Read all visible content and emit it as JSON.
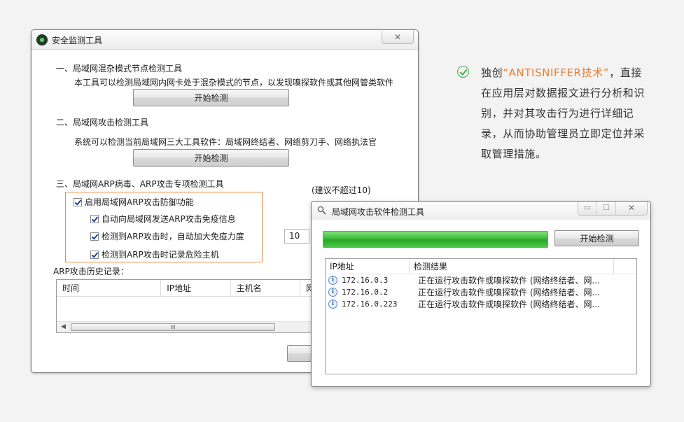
{
  "main_window": {
    "title": "安全监测工具",
    "close_glyph": "✕",
    "section1": {
      "title": "一、局域网混杂模式节点检测工具",
      "desc": "本工具可以检测局域网内网卡处于混杂模式的节点，以发现嗅探软件或其他网管类软件",
      "button": "开始检测"
    },
    "section2": {
      "title": "二、局域网攻击检测工具",
      "desc": "系统可以检测当前局域网三大工具软件：局域网终结者、网络剪刀手、网络执法官",
      "button": "开始检测"
    },
    "section3": {
      "title": "三、局域网ARP病毒、ARP攻击专项检测工具",
      "hint": "(建议不超过10)",
      "enable_label": "启用局域网ARP攻击防御功能",
      "opt1_label": "自动向局域网发送ARP攻击免疫信息",
      "opt2_label": "检测到ARP攻击时，自动加大免疫力度",
      "opt3_label": "检测到ARP攻击时记录危险主机",
      "immunity_value": "10",
      "checked": [
        true,
        true,
        true,
        true
      ]
    },
    "history": {
      "label": "ARP攻击历史记录：",
      "columns": [
        "时间",
        "IP地址",
        "主机名",
        "网"
      ],
      "scroll_grip": "III"
    }
  },
  "detect_window": {
    "title": "局域网攻击软件检测工具",
    "min_glyph": "▭",
    "max_glyph": "☐",
    "close_glyph": "✕",
    "progress": 1.0,
    "button": "开始检测",
    "columns": [
      "IP地址",
      "检测结果"
    ],
    "rows": [
      {
        "ip": "172.16.0.3",
        "result": "正在运行攻击软件或嗅探软件 (网络终结者、网..."
      },
      {
        "ip": "172.16.0.2",
        "result": "正在运行攻击软件或嗅探软件 (网络终结者、网..."
      },
      {
        "ip": "172.16.0.223",
        "result": "正在运行攻击软件或嗅探软件 (网络终结者、网..."
      }
    ]
  },
  "feature": {
    "prefix": "独创",
    "highlight": "“ANTISNIFFER技术”",
    "body": "，直接在应用层对数据报文进行分析和识别，并对其攻击行为进行详细记录，从而协助管理员立即定位并采取管理措施。"
  },
  "colors": {
    "accent_orange": "#f07c2d",
    "check_green": "#3fae49",
    "progress_green": "#3dbb3a"
  }
}
